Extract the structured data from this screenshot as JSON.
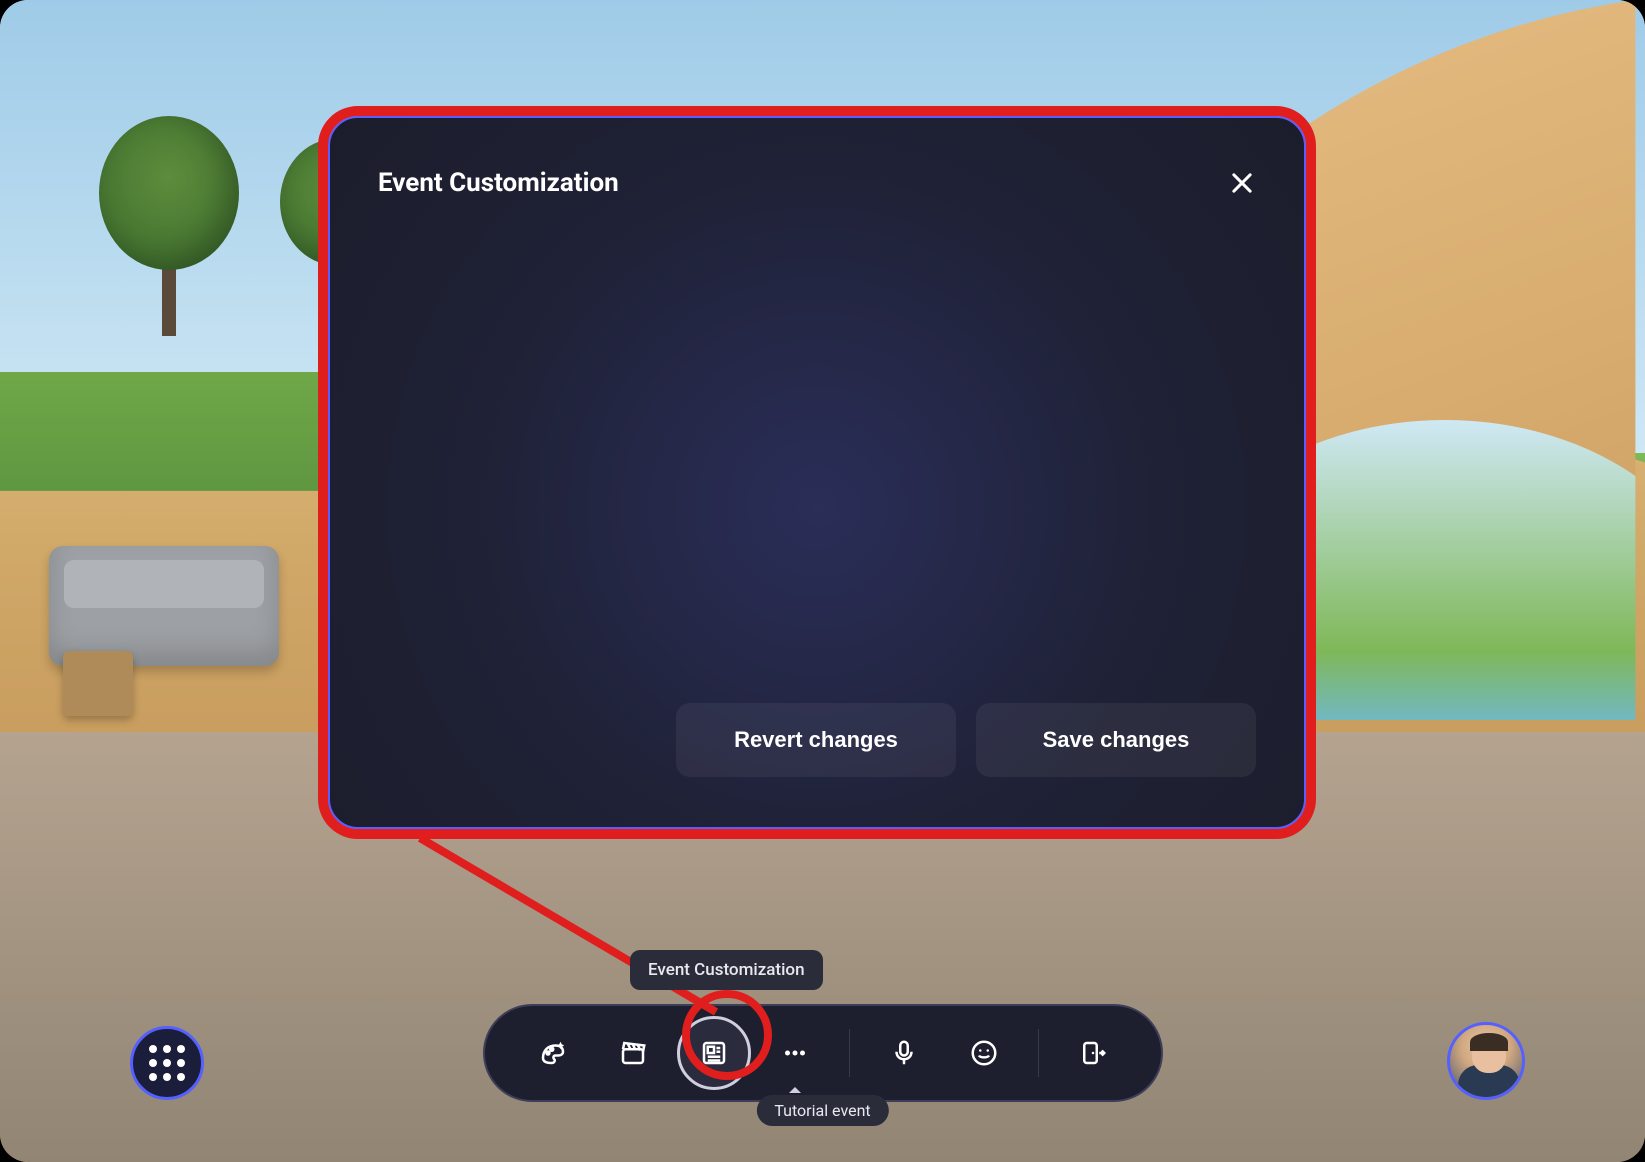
{
  "modal": {
    "title": "Event Customization",
    "revert_label": "Revert changes",
    "save_label": "Save changes"
  },
  "tooltip": {
    "text": "Event Customization"
  },
  "event": {
    "label": "Tutorial event"
  },
  "toolbar": {
    "buttons": [
      {
        "name": "environment",
        "icon": "palette-sparkle-icon"
      },
      {
        "name": "scene",
        "icon": "clapper-icon"
      },
      {
        "name": "customization",
        "icon": "newspaper-icon",
        "active": true
      },
      {
        "name": "more",
        "icon": "ellipsis-icon",
        "caret": true
      },
      {
        "name": "mic",
        "icon": "microphone-icon"
      },
      {
        "name": "react",
        "icon": "smile-icon"
      },
      {
        "name": "leave",
        "icon": "door-exit-icon"
      }
    ]
  },
  "colors": {
    "accent": "#5560ff",
    "highlight": "#e01e1e",
    "panel": "#1e1f2e"
  }
}
